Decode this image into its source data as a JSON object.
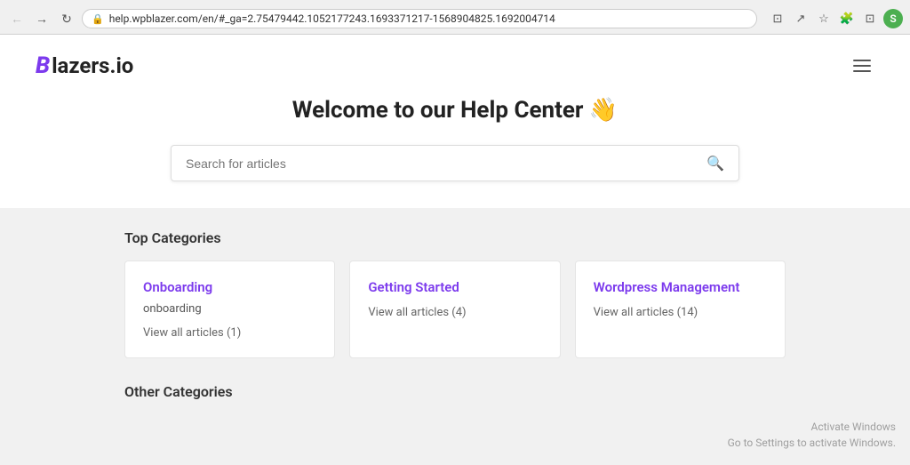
{
  "browser": {
    "url": "help.wpblazer.com/en/#_ga=2.75479442.1052177243.1693371217-1568904825.1692004714",
    "lock_icon": "🔒",
    "profile_initial": "S",
    "nav": {
      "back_label": "←",
      "forward_label": "→",
      "refresh_label": "↻"
    }
  },
  "hero": {
    "logo_b": "B",
    "logo_rest": "lazers.io",
    "title": "Welcome to our Help Center 👋",
    "search_placeholder": "Search for articles"
  },
  "top_categories": {
    "section_title": "Top Categories",
    "cards": [
      {
        "name": "Onboarding",
        "desc": "onboarding",
        "link": "View all articles (1)"
      },
      {
        "name": "Getting Started",
        "desc": "",
        "link": "View all articles (4)"
      },
      {
        "name": "Wordpress Management",
        "desc": "",
        "link": "View all articles (14)"
      }
    ]
  },
  "other_categories": {
    "section_title": "Other Categories"
  },
  "windows": {
    "line1": "Activate Windows",
    "line2": "Go to Settings to activate Windows."
  }
}
